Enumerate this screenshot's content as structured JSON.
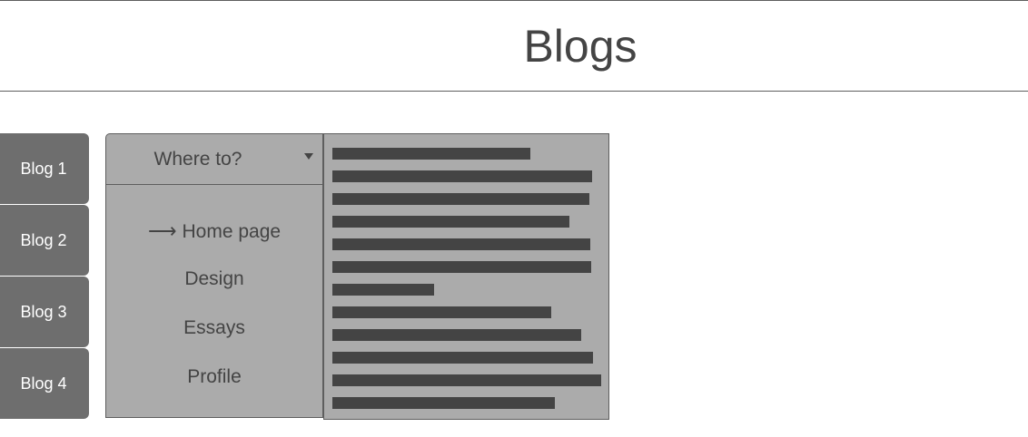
{
  "header": {
    "title": "Blogs"
  },
  "tabs": [
    {
      "label": "Blog 1"
    },
    {
      "label": "Blog 2"
    },
    {
      "label": "Blog 3"
    },
    {
      "label": "Blog 4"
    }
  ],
  "menu": {
    "header_label": "Where to?",
    "items": [
      {
        "label": "Home page",
        "current": true
      },
      {
        "label": "Design"
      },
      {
        "label": "Essays"
      },
      {
        "label": "Profile"
      }
    ]
  },
  "colors": {
    "tab": "#6e6e6e",
    "panel": "#ababab",
    "text_bar": "#444444",
    "rule": "#5e5e5e"
  }
}
